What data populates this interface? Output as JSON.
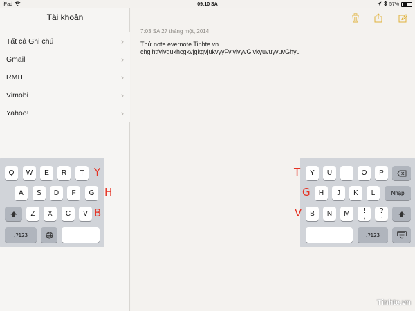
{
  "status": {
    "device": "iPad",
    "wifi_icon": "wifi-icon",
    "time": "09:10 SA",
    "battery": "57%",
    "battery_level": 0.57
  },
  "sidebar": {
    "title": "Tài khoản",
    "items": [
      {
        "label": "Tất cả Ghi chú"
      },
      {
        "label": "Gmail"
      },
      {
        "label": "RMIT"
      },
      {
        "label": "Vimobi"
      },
      {
        "label": "Yahoo!"
      }
    ]
  },
  "note": {
    "date": "7:03 SA 27 tháng một, 2014",
    "line1": "Thử note evernote Tinhte.vn",
    "line2": "chgjhtfyivgukhcgkvjgkgvjukvyyFvjylvyvGjvkyuvuyvuvGhyu"
  },
  "keyboard": {
    "left": {
      "row1": [
        "Q",
        "W",
        "E",
        "R",
        "T"
      ],
      "row2": [
        "A",
        "S",
        "D",
        "F",
        "G"
      ],
      "row3": [
        "Z",
        "X",
        "C",
        "V"
      ],
      "numbers": ".?123"
    },
    "right": {
      "row1": [
        "Y",
        "U",
        "I",
        "O",
        "P"
      ],
      "row2": [
        "H",
        "J",
        "K",
        "L"
      ],
      "row2_action": "Nhập",
      "row3": [
        "B",
        "N",
        "M",
        "!",
        "?"
      ],
      "row3_sub": [
        ",",
        "."
      ],
      "numbers": ".?123"
    }
  },
  "annotations": {
    "left": [
      "Y",
      "H",
      "B"
    ],
    "right": [
      "T",
      "G",
      "V"
    ]
  },
  "colors": {
    "accent": "#e0b23b",
    "annotation": "#e53324"
  },
  "watermark": "Tinhte.vn"
}
